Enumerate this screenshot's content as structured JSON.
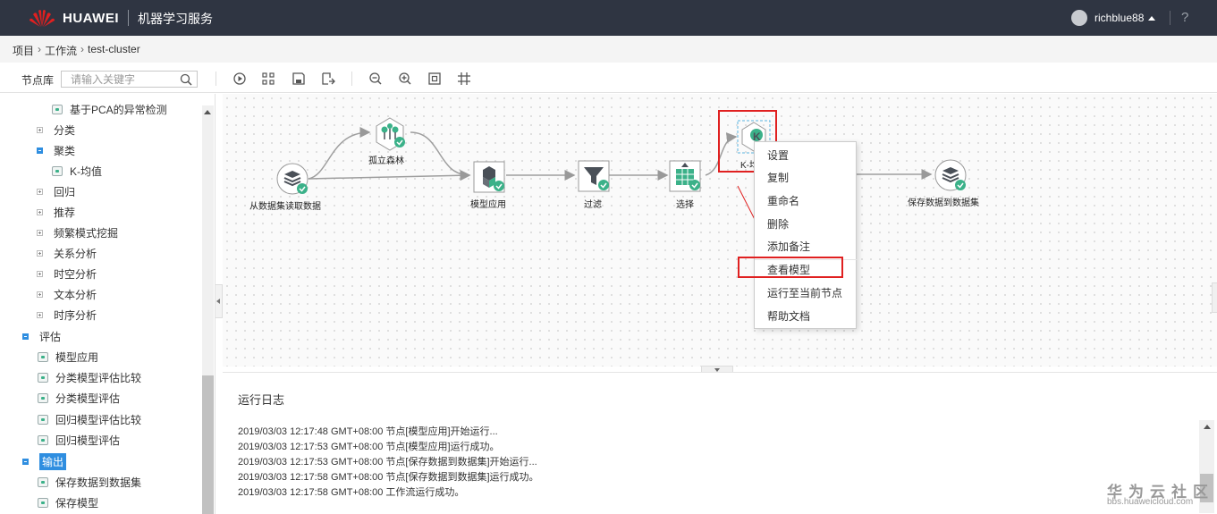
{
  "header": {
    "brand": "HUAWEI",
    "app_name": "机器学习服务",
    "username": "richblue88",
    "help": "?"
  },
  "breadcrumb": [
    "项目",
    "工作流",
    "test-cluster"
  ],
  "toolbar": {
    "node_lib_label": "节点库",
    "search_placeholder": "请输入关键字",
    "buttons": [
      "run-icon",
      "layout-icon",
      "save-icon",
      "export-icon",
      "zoom-out-icon",
      "zoom-in-icon",
      "fit-icon",
      "grid-icon"
    ]
  },
  "sidebar": {
    "items": [
      {
        "label": "基于PCA的异常检测",
        "type": "leaf"
      },
      {
        "label": "分类",
        "type": "collapsed"
      },
      {
        "label": "聚类",
        "type": "expanded"
      },
      {
        "label": "K-均值",
        "type": "leaf"
      },
      {
        "label": "回归",
        "type": "collapsed"
      },
      {
        "label": "推荐",
        "type": "collapsed"
      },
      {
        "label": "频繁模式挖掘",
        "type": "collapsed"
      },
      {
        "label": "关系分析",
        "type": "collapsed"
      },
      {
        "label": "时空分析",
        "type": "collapsed"
      },
      {
        "label": "文本分析",
        "type": "collapsed"
      },
      {
        "label": "时序分析",
        "type": "collapsed"
      },
      {
        "label": "评估",
        "type": "expanded"
      },
      {
        "label": "模型应用",
        "type": "leaf"
      },
      {
        "label": "分类模型评估比较",
        "type": "leaf"
      },
      {
        "label": "分类模型评估",
        "type": "leaf"
      },
      {
        "label": "回归模型评估比较",
        "type": "leaf"
      },
      {
        "label": "回归模型评估",
        "type": "leaf"
      },
      {
        "label": "输出",
        "type": "expanded-selected"
      },
      {
        "label": "保存数据到数据集",
        "type": "leaf"
      },
      {
        "label": "保存模型",
        "type": "leaf"
      }
    ]
  },
  "workflow": {
    "nodes": [
      {
        "label": "从数据集读取数据",
        "icon": "dataset-icon",
        "status": "success"
      },
      {
        "label": "孤立森林",
        "icon": "forest-icon",
        "status": "success"
      },
      {
        "label": "模型应用",
        "icon": "model-apply-icon",
        "status": "success"
      },
      {
        "label": "过滤",
        "icon": "filter-icon",
        "status": "success"
      },
      {
        "label": "选择",
        "icon": "select-icon",
        "status": "success"
      },
      {
        "label": "K-均",
        "icon": "kmeans-icon",
        "status": "selected"
      },
      {
        "label": "保存数据到数据集",
        "icon": "save-dataset-icon",
        "status": "success"
      }
    ]
  },
  "context_menu": {
    "items": [
      "设置",
      "复制",
      "重命名",
      "删除",
      "添加备注",
      "查看模型",
      "运行至当前节点",
      "帮助文档"
    ],
    "highlighted": "查看模型"
  },
  "log": {
    "title": "运行日志",
    "lines": [
      "2019/03/03 12:17:48 GMT+08:00 节点[模型应用]开始运行...",
      "2019/03/03 12:17:53 GMT+08:00 节点[模型应用]运行成功。",
      "2019/03/03 12:17:53 GMT+08:00 节点[保存数据到数据集]开始运行...",
      "2019/03/03 12:17:58 GMT+08:00 节点[保存数据到数据集]运行成功。",
      "2019/03/03 12:17:58 GMT+08:00 工作流运行成功。"
    ]
  },
  "watermark": {
    "text": "华为云社区",
    "url": "bbs.huaweicloud.com"
  },
  "colors": {
    "topbar": "#2f3542",
    "accent": "#2f8ee0",
    "success": "#3bb189",
    "highlight_box": "#e02020"
  }
}
